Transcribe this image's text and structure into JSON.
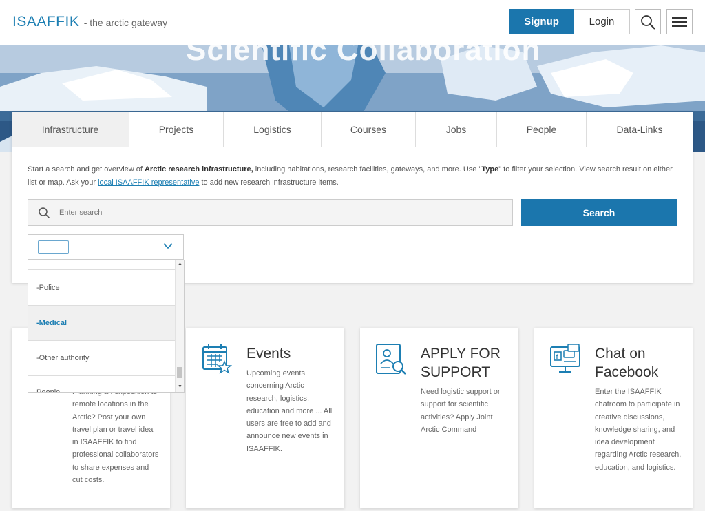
{
  "header": {
    "logo": "ISAAFFIK",
    "tagline": "- the arctic gateway",
    "signup_label": "Signup",
    "login_label": "Login"
  },
  "hero": {
    "title": "Scientific Collaboration"
  },
  "tabs": [
    {
      "label": "Infrastructure",
      "active": true
    },
    {
      "label": "Projects"
    },
    {
      "label": "Logistics"
    },
    {
      "label": "Courses"
    },
    {
      "label": "Jobs"
    },
    {
      "label": "People"
    },
    {
      "label": "Data-Links"
    }
  ],
  "search": {
    "intro_part1": "Start a search and get overview of ",
    "intro_bold": "Arctic research infrastructure,",
    "intro_part2": " including habitations, research facilities, gateways, and more. Use \"",
    "intro_type": "Type",
    "intro_part3": "\" to filter your selection. View search result on either list or map. Ask your ",
    "intro_link": "local ISAAFFIK representative",
    "intro_part4": " to add new research infrastructure items.",
    "placeholder": "Enter search",
    "button_label": "Search"
  },
  "type_dropdown": {
    "items": [
      {
        "label": "-Police",
        "selected": false
      },
      {
        "label": "-Medical",
        "selected": true
      },
      {
        "label": "-Other authority",
        "selected": false
      },
      {
        "label": "People",
        "selected": false
      }
    ]
  },
  "cards": [
    {
      "title": "",
      "text": "Planning an expedition to remote locations in the Arctic? Post your own travel plan or travel idea in ISAAFFIK to find professional collaborators to share expenses and cut costs."
    },
    {
      "title": "Events",
      "text": "Upcoming events concerning Arctic research, logistics, education and more ... All users are free to add and announce new events in ISAAFFIK.",
      "icon": "calendar-star-icon"
    },
    {
      "title": "APPLY FOR SUPPORT",
      "text": "Need logistic support or support for scientific activities? Apply Joint Arctic Command",
      "icon": "application-document-icon"
    },
    {
      "title": "Chat on Facebook",
      "text": "Enter the ISAAFFIK chatroom to participate in creative discussions, knowledge sharing, and idea development regarding Arctic research, education, and logistics.",
      "icon": "facebook-chat-monitor-icon"
    }
  ],
  "colors": {
    "accent": "#1b76ad",
    "brand": "#1d7fb3"
  }
}
